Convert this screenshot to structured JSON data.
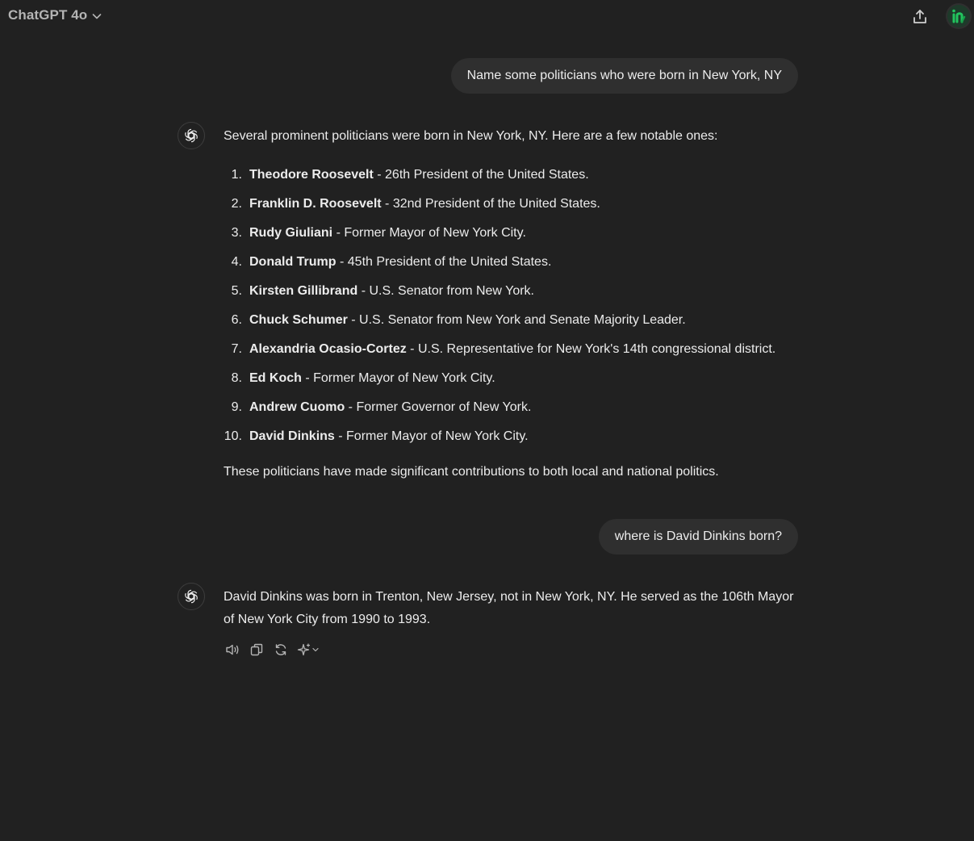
{
  "header": {
    "title": "ChatGPT 4o",
    "chevron_icon": "chevron-down-icon",
    "share_icon": "share-upload-icon",
    "avatar_icon": "user-avatar"
  },
  "messages": [
    {
      "role": "user",
      "text": "Name some politicians who were born in New York, NY"
    },
    {
      "role": "assistant",
      "intro": "Several prominent politicians were born in New York, NY. Here are a few notable ones:",
      "list": [
        {
          "num": "1.",
          "name": "Theodore Roosevelt",
          "desc": " - 26th President of the United States."
        },
        {
          "num": "2.",
          "name": "Franklin D. Roosevelt",
          "desc": " - 32nd President of the United States."
        },
        {
          "num": "3.",
          "name": "Rudy Giuliani",
          "desc": " - Former Mayor of New York City."
        },
        {
          "num": "4.",
          "name": "Donald Trump",
          "desc": " - 45th President of the United States."
        },
        {
          "num": "5.",
          "name": "Kirsten Gillibrand",
          "desc": " - U.S. Senator from New York."
        },
        {
          "num": "6.",
          "name": "Chuck Schumer",
          "desc": " - U.S. Senator from New York and Senate Majority Leader."
        },
        {
          "num": "7.",
          "name": "Alexandria Ocasio-Cortez",
          "desc": " - U.S. Representative for New York's 14th congressional district."
        },
        {
          "num": "8.",
          "name": "Ed Koch",
          "desc": " - Former Mayor of New York City."
        },
        {
          "num": "9.",
          "name": "Andrew Cuomo",
          "desc": " - Former Governor of New York."
        },
        {
          "num": "10.",
          "name": "David Dinkins",
          "desc": " - Former Mayor of New York City."
        }
      ],
      "outro": "These politicians have made significant contributions to both local and national politics."
    },
    {
      "role": "user",
      "text": "where is David Dinkins born?"
    },
    {
      "role": "assistant",
      "text": "David Dinkins was born in Trenton, New Jersey, not in New York, NY. He served as the 106th Mayor of New York City from 1990 to 1993."
    }
  ],
  "actions": {
    "read_aloud_icon": "speaker-icon",
    "copy_icon": "copy-icon",
    "regenerate_icon": "refresh-icon",
    "model_switch_icon": "sparkle-icon"
  },
  "colors": {
    "background": "#212121",
    "bubble": "#2f2f2f",
    "text": "#ececec",
    "muted": "#b4b4b4",
    "avatar_accent": "#10a37f"
  }
}
